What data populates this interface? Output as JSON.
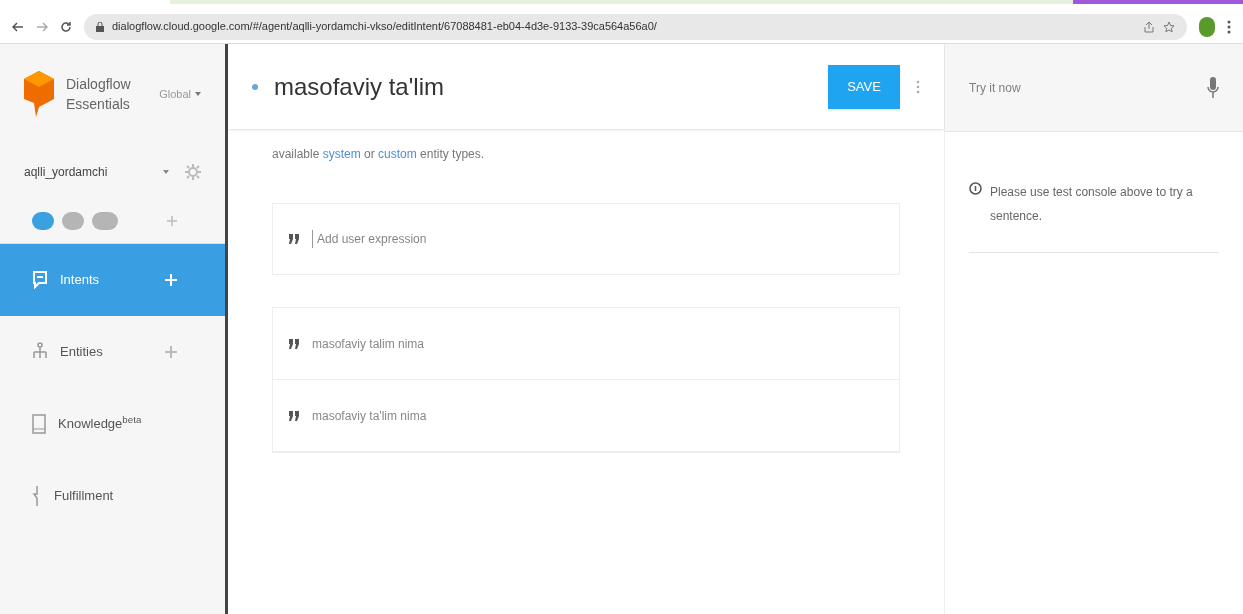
{
  "browser": {
    "url": "dialogflow.cloud.google.com/#/agent/aqlli-yordamchi-vkso/editIntent/67088481-eb04-4d3e-9133-39ca564a56a0/"
  },
  "sidebar": {
    "brand": [
      "Dialogflow",
      "Essentials"
    ],
    "region": "Global",
    "agent": "aqlli_yordamchi",
    "nav": [
      {
        "kind": "intents",
        "label": "Intents",
        "selected": true,
        "add": true
      },
      {
        "kind": "entities",
        "label": "Entities",
        "selected": false,
        "add": true
      },
      {
        "kind": "knowledge",
        "label": "Knowledge$^{beta}$",
        "selected": false,
        "add": false
      },
      {
        "kind": "fulfillment",
        "label": "Fulfillment",
        "selected": false,
        "add": false
      }
    ]
  },
  "intent": {
    "title": "masofaviy ta'lim",
    "save": "SAVE",
    "hint": [
      {
        "kind": "text",
        "text": "available "
      },
      {
        "kind": "link",
        "text": "system"
      },
      {
        "kind": "text",
        "text": " or "
      },
      {
        "kind": "link",
        "text": "custom"
      },
      {
        "kind": "text",
        "text": " entity types."
      }
    ],
    "expression_placeholder": "Add user expression",
    "expressions": [
      "masofaviy talim nima",
      "masofaviy ta'lim nima"
    ]
  },
  "console": {
    "placeholder": "Try it now",
    "message": "Please use test console above to try a sentence."
  }
}
